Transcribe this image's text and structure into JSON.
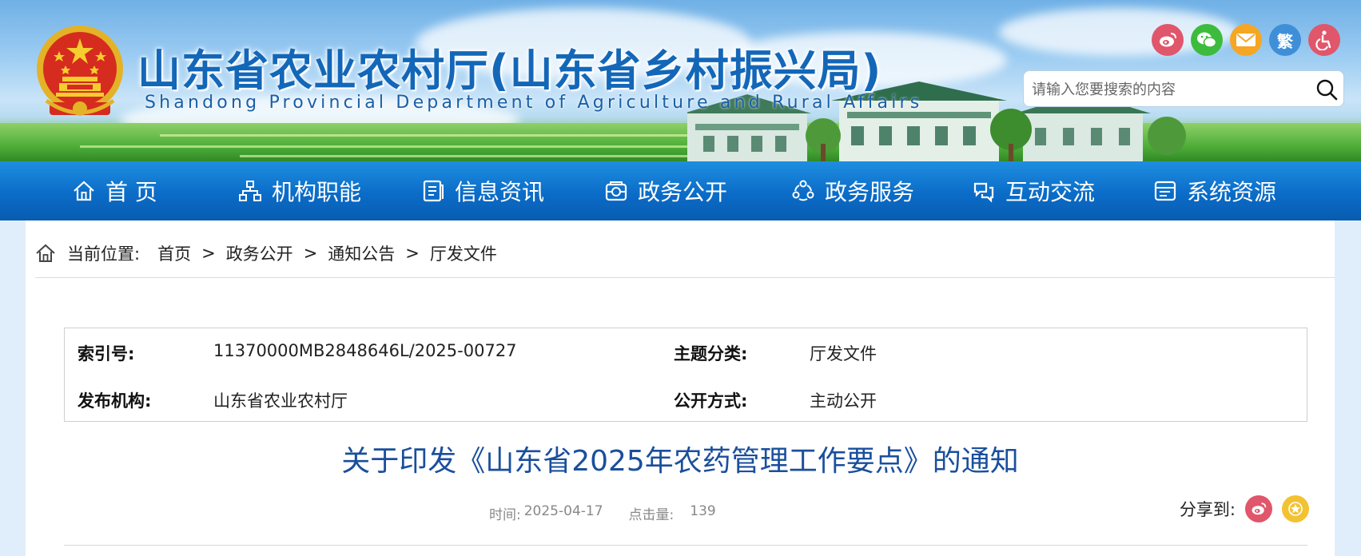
{
  "header": {
    "title": "山东省农业农村厅(山东省乡村振兴局)",
    "subtitle": "Shandong Provincial Department of Agriculture and Rural Affairs",
    "traditional_label": "繁",
    "search_placeholder": "请输入您要搜索的内容",
    "icons": [
      "weibo-icon",
      "wechat-icon",
      "mail-icon",
      "traditional-chinese-toggle",
      "accessibility-icon"
    ],
    "colors": {
      "weibo": "#e0566b",
      "wechat": "#3dbb3d",
      "mail": "#f5a623",
      "traditional": "#3f8fd8",
      "accessibility": "#e0566b"
    }
  },
  "nav": {
    "items": [
      {
        "label": "首 页",
        "icon": "home-icon"
      },
      {
        "label": "机构职能",
        "icon": "org-icon"
      },
      {
        "label": "信息资讯",
        "icon": "news-icon"
      },
      {
        "label": "政务公开",
        "icon": "open-gov-icon"
      },
      {
        "label": "政务服务",
        "icon": "service-icon"
      },
      {
        "label": "互动交流",
        "icon": "interaction-icon"
      },
      {
        "label": "系统资源",
        "icon": "resource-icon"
      }
    ],
    "color": "#0b6cc8"
  },
  "breadcrumb": {
    "label": "当前位置:",
    "items": [
      "首页",
      "政务公开",
      "通知公告",
      "厅发文件"
    ],
    "separator": ">"
  },
  "meta": {
    "index_label": "索引号:",
    "index_value": "11370000MB2848646L/2025-00727",
    "topic_label": "主题分类:",
    "topic_value": "厅发文件",
    "publisher_label": "发布机构:",
    "publisher_value": "山东省农业农村厅",
    "disclosure_label": "公开方式:",
    "disclosure_value": "主动公开"
  },
  "document": {
    "title": "关于印发《山东省2025年农药管理工作要点》的通知",
    "time_label": "时间:",
    "time_value": "2025-04-17",
    "clicks_label": "点击量:",
    "clicks_value": "139",
    "title_color": "#1a4f9c"
  },
  "share": {
    "label": "分享到:",
    "icons": [
      "weibo-icon",
      "favorite-icon"
    ]
  }
}
